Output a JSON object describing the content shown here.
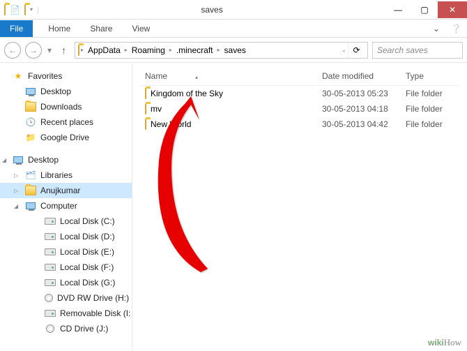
{
  "window": {
    "title": "saves",
    "search_placeholder": "Search saves"
  },
  "menu": {
    "file": "File",
    "tabs": [
      "Home",
      "Share",
      "View"
    ]
  },
  "breadcrumbs": [
    "AppData",
    "Roaming",
    ".minecraft",
    "saves"
  ],
  "columns": {
    "name": "Name",
    "date": "Date modified",
    "type": "Type"
  },
  "favorites": {
    "header": "Favorites",
    "items": [
      {
        "label": "Desktop",
        "icon": "desktop"
      },
      {
        "label": "Downloads",
        "icon": "folder"
      },
      {
        "label": "Recent places",
        "icon": "recent"
      },
      {
        "label": "Google Drive",
        "icon": "gdrive"
      }
    ]
  },
  "tree": {
    "root": "Desktop",
    "libraries": "Libraries",
    "user": "Anujkumar",
    "computer": "Computer",
    "drives": [
      "Local Disk (C:)",
      "Local Disk (D:)",
      "Local Disk (E:)",
      "Local Disk (F:)",
      "Local Disk (G:)",
      "DVD RW Drive (H:)",
      "Removable Disk (I:",
      "CD Drive (J:)"
    ]
  },
  "files": [
    {
      "name": "Kingdom of the Sky",
      "date": "30-05-2013 05:23",
      "type": "File folder"
    },
    {
      "name": "mv",
      "date": "30-05-2013 04:18",
      "type": "File folder"
    },
    {
      "name": "New World",
      "date": "30-05-2013 04:42",
      "type": "File folder"
    }
  ],
  "watermark": "wikiHow"
}
